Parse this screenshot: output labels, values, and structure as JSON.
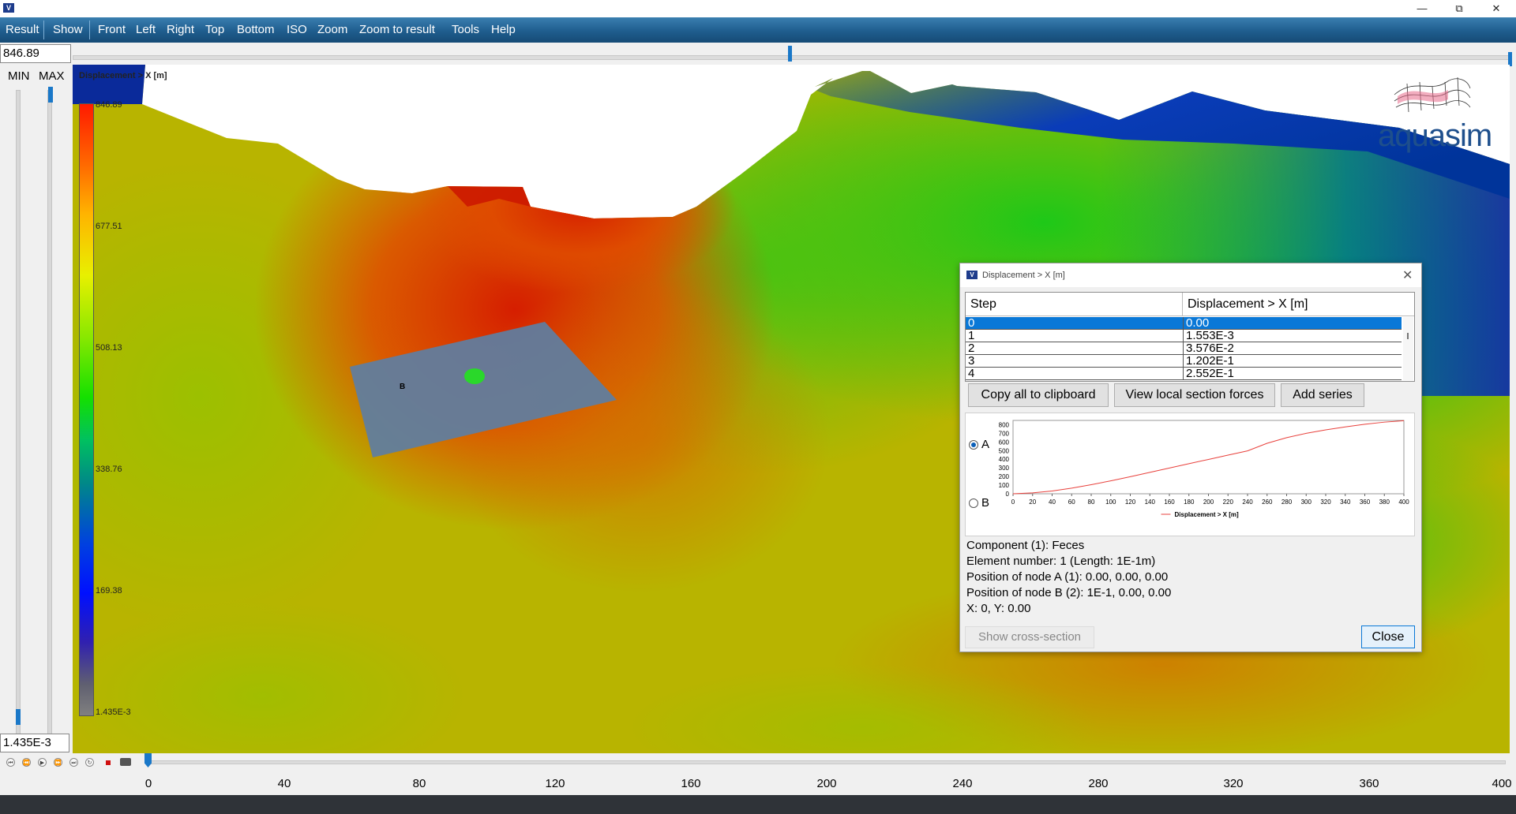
{
  "menu": [
    "Result",
    "Show",
    "Front",
    "Left",
    "Right",
    "Top",
    "Bottom",
    "ISO",
    "Zoom",
    "Zoom to result",
    "Tools",
    "Help"
  ],
  "max_value": "846.89",
  "min_value": "1.435E-3",
  "left_panel": {
    "min_label": "MIN",
    "max_label": "MAX"
  },
  "legend": {
    "title": "Displacement > X [m]",
    "labels": [
      "846.89",
      "677.51",
      "508.13",
      "338.76",
      "169.38",
      "1.435E-3"
    ]
  },
  "logo": "aquasim",
  "node_label": "B",
  "dialog": {
    "title": "Displacement > X [m]",
    "table": {
      "headers": [
        "Step",
        "Displacement > X [m]"
      ],
      "rows": [
        [
          "0",
          "0.00"
        ],
        [
          "1",
          "1.553E-3"
        ],
        [
          "2",
          "3.576E-2"
        ],
        [
          "3",
          "1.202E-1"
        ],
        [
          "4",
          "2.552E-1"
        ]
      ]
    },
    "buttons": {
      "copy": "Copy all to clipboard",
      "view": "View local section forces",
      "add": "Add series"
    },
    "radio_a": "A",
    "radio_b": "B",
    "info": [
      "Component (1): Feces",
      "Element number: 1 (Length: 1E-1m)",
      "Position of node A (1): 0.00, 0.00, 0.00",
      "Position of node B (2): 1E-1, 0.00, 0.00",
      "X: 0, Y: 0.00"
    ],
    "show_cross_section": "Show cross-section",
    "close": "Close"
  },
  "timeline": {
    "ticks": [
      "0",
      "40",
      "80",
      "120",
      "160",
      "200",
      "240",
      "280",
      "320",
      "360",
      "400"
    ],
    "min": 0,
    "max": 400
  },
  "colors": {
    "menu_bar": "#1f5d8e",
    "selection": "#0a78d7",
    "series": "#e8413c"
  },
  "chart_data": {
    "type": "line",
    "x": [
      0,
      20,
      40,
      60,
      80,
      100,
      120,
      140,
      160,
      180,
      200,
      220,
      240,
      260,
      280,
      300,
      320,
      340,
      360,
      380,
      400
    ],
    "series": [
      {
        "name": "Displacement > X [m]",
        "values": [
          0,
          10,
          32,
          65,
          105,
          150,
          198,
          248,
          298,
          348,
          398,
          448,
          497,
          585,
          650,
          700,
          740,
          775,
          805,
          830,
          846.89
        ]
      }
    ],
    "xticks": [
      "0",
      "20",
      "40",
      "60",
      "80",
      "100",
      "120",
      "140",
      "160",
      "180",
      "200",
      "220",
      "240",
      "260",
      "280",
      "300",
      "320",
      "340",
      "360",
      "380",
      "400"
    ],
    "yticks": [
      "0",
      "100",
      "200",
      "300",
      "400",
      "500",
      "600",
      "700",
      "800"
    ],
    "xlim": [
      0,
      400
    ],
    "ylim": [
      0,
      850
    ],
    "legend": "bottom"
  }
}
